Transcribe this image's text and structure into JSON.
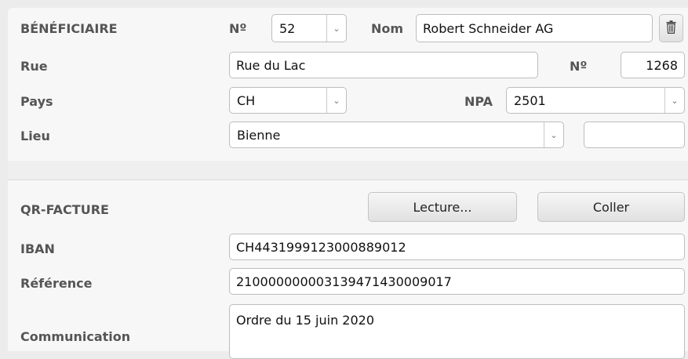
{
  "beneficiary": {
    "section_label": "BÉNÉFICIAIRE",
    "no_label": "Nº",
    "no_value": "52",
    "name_label": "Nom",
    "name_value": "Robert Schneider AG",
    "delete_icon": "trash-icon",
    "street_label": "Rue",
    "street_value": "Rue du Lac",
    "street_no_label": "Nº",
    "street_no_value": "1268",
    "country_label": "Pays",
    "country_value": "CH",
    "npa_label": "NPA",
    "npa_value": "2501",
    "city_label": "Lieu",
    "city_value": "Bienne",
    "extra_value": ""
  },
  "qr": {
    "section_label": "QR-FACTURE",
    "read_button": "Lecture...",
    "paste_button": "Coller",
    "iban_label": "IBAN",
    "iban_value": "CH4431999123000889012",
    "reference_label": "Référence",
    "reference_value": "210000000003139471430009017",
    "communication_label": "Communication",
    "communication_value": "Ordre du 15 juin 2020"
  }
}
